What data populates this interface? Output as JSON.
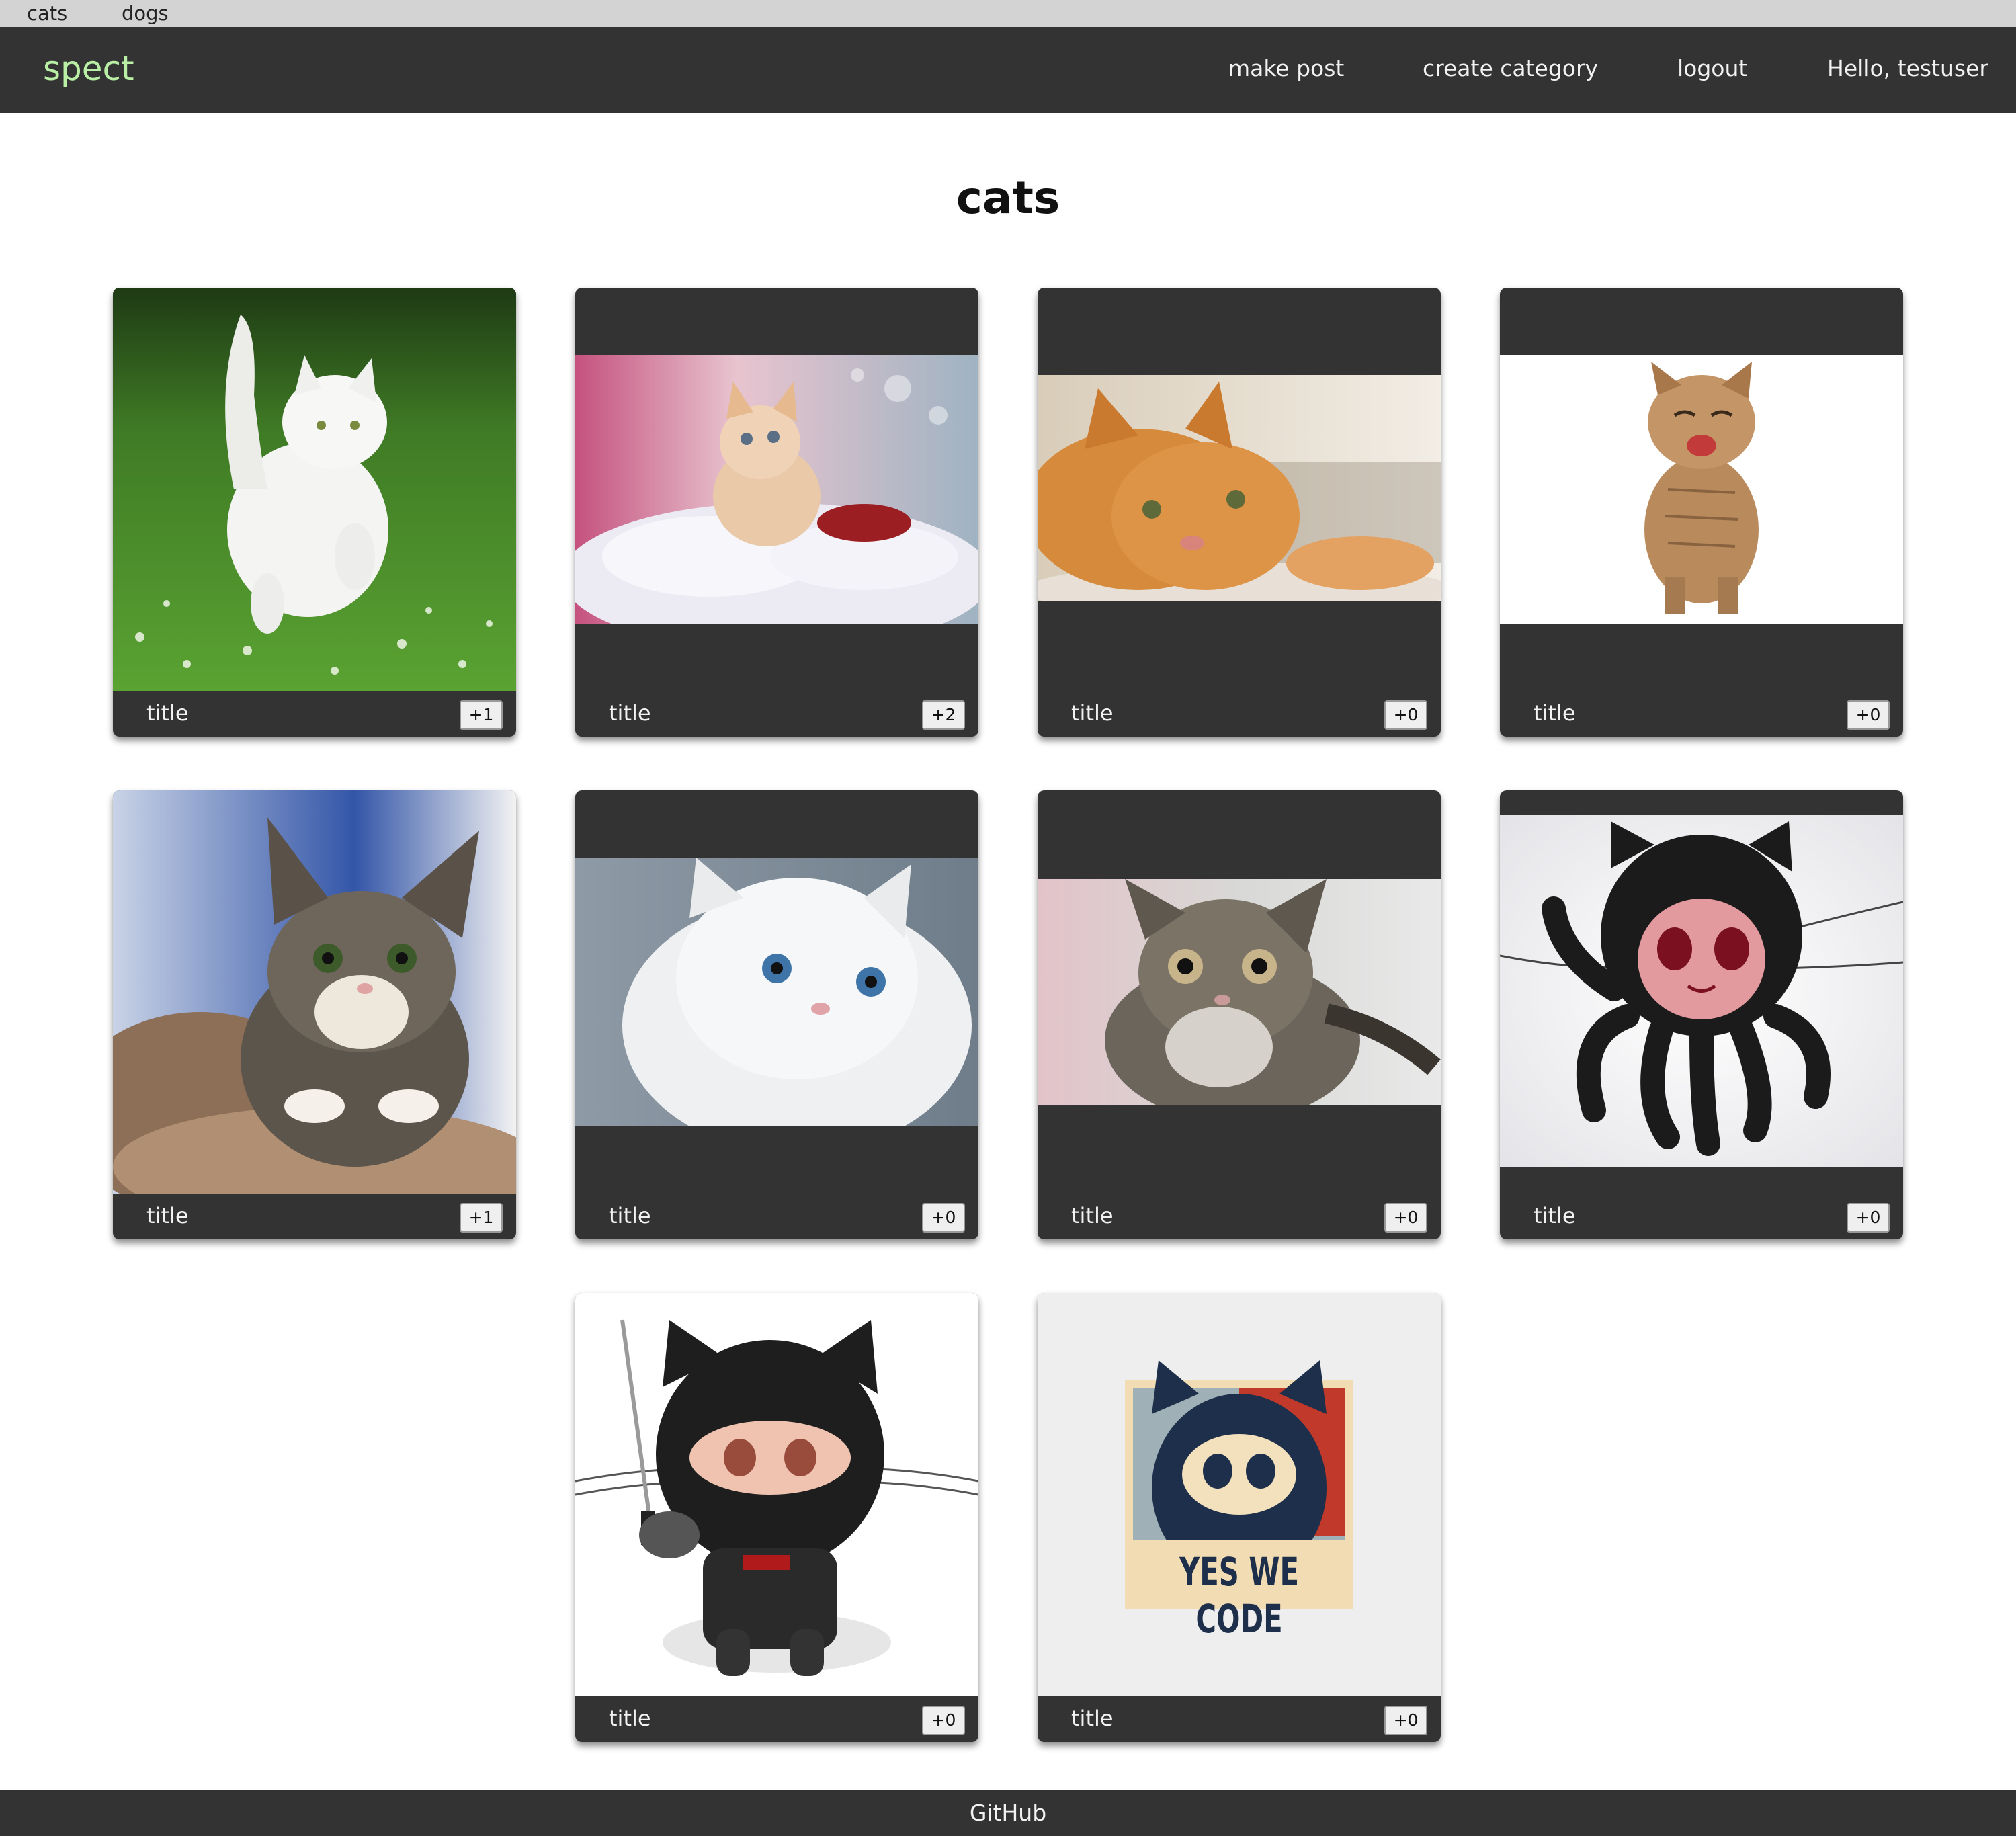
{
  "categories_bar": {
    "items": [
      "cats",
      "dogs"
    ]
  },
  "navbar": {
    "brand": "spect",
    "links": [
      "make post",
      "create category",
      "logout"
    ],
    "greeting": "Hello, testuser"
  },
  "page": {
    "title": "cats"
  },
  "posts": [
    {
      "title": "title",
      "votes": "+1"
    },
    {
      "title": "title",
      "votes": "+2"
    },
    {
      "title": "title",
      "votes": "+0"
    },
    {
      "title": "title",
      "votes": "+0"
    },
    {
      "title": "title",
      "votes": "+1"
    },
    {
      "title": "title",
      "votes": "+0"
    },
    {
      "title": "title",
      "votes": "+0"
    },
    {
      "title": "title",
      "votes": "+0"
    },
    {
      "title": "title",
      "votes": "+0"
    },
    {
      "title": "title",
      "votes": "+0"
    }
  ],
  "images": {
    "poster_caption": "YES WE CODE"
  },
  "footer": {
    "link": "GitHub"
  },
  "colors": {
    "bar_bg": "#333333",
    "category_strip_bg": "#d3d3d3",
    "brand": "#b9f0a6"
  }
}
